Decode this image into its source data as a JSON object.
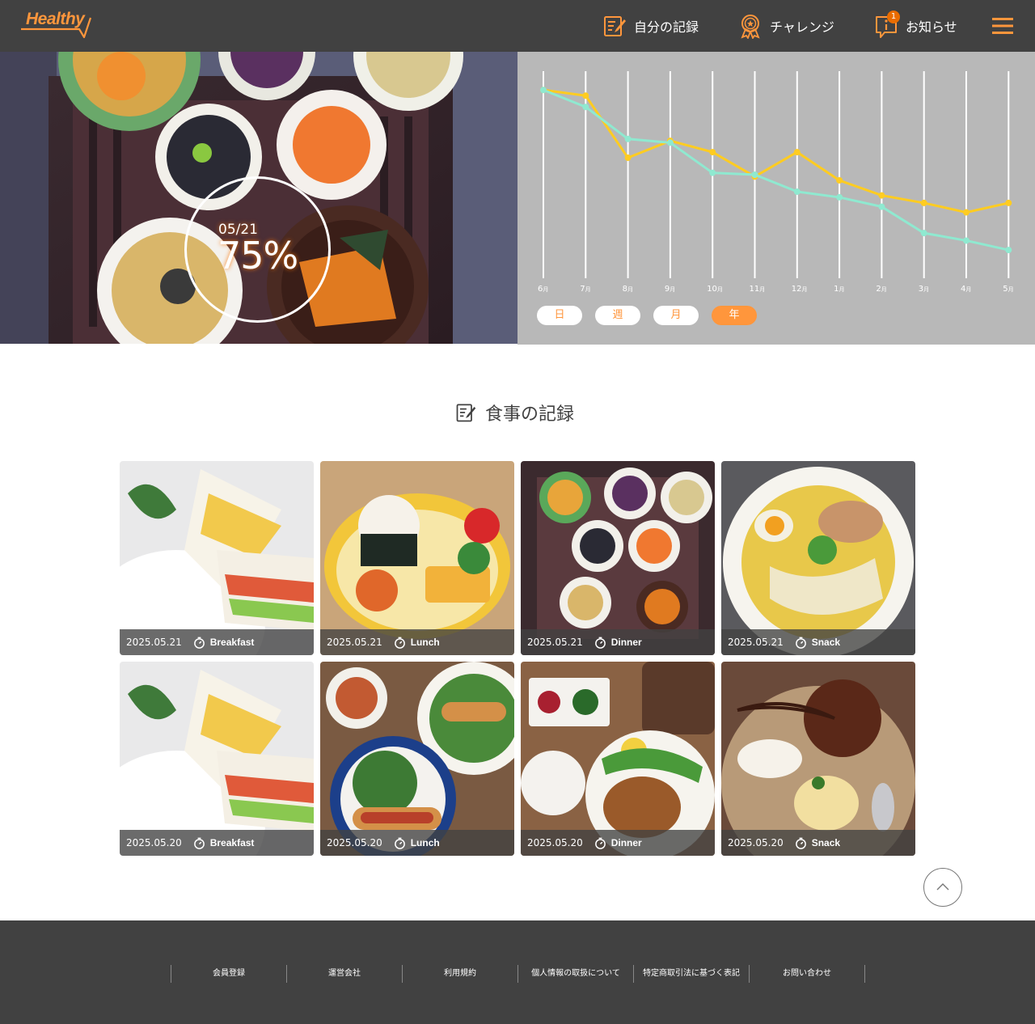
{
  "header": {
    "logo": "Healthy",
    "nav": [
      {
        "label": "自分の記録",
        "icon": "memo-icon"
      },
      {
        "label": "チャレンジ",
        "icon": "medal-icon"
      },
      {
        "label": "お知らせ",
        "icon": "info-icon",
        "badge": "1"
      }
    ],
    "menu_icon": "hamburger-icon"
  },
  "hero": {
    "date": "05/21",
    "percent": "75%",
    "achievement_rate": 0.75
  },
  "chart_data": {
    "type": "line",
    "categories": [
      "6",
      "7",
      "8",
      "9",
      "10",
      "11",
      "12",
      "1",
      "2",
      "3",
      "4",
      "5"
    ],
    "month_unit": "月",
    "series": [
      {
        "color": "#FFCC21",
        "values": [
          100,
          97,
          64,
          73,
          67,
          54,
          67,
          52,
          44,
          40,
          35,
          40
        ]
      },
      {
        "color": "#8FE9D0",
        "values": [
          100,
          91,
          74,
          72,
          56,
          55,
          46,
          43,
          38,
          24,
          20,
          15
        ]
      }
    ],
    "ylim": [
      0,
      110
    ],
    "grid": "vertical",
    "legend": "none"
  },
  "range_buttons": [
    "日",
    "週",
    "月",
    "年"
  ],
  "range_selected": "年",
  "meals_section": {
    "title": "食事の記録",
    "icon": "memo-icon"
  },
  "meals": [
    {
      "date": "2025.05.21",
      "meal": "Breakfast",
      "kind": "sandwich"
    },
    {
      "date": "2025.05.21",
      "meal": "Lunch",
      "kind": "bento"
    },
    {
      "date": "2025.05.21",
      "meal": "Dinner",
      "kind": "dishes"
    },
    {
      "date": "2025.05.21",
      "meal": "Snack",
      "kind": "ramen"
    },
    {
      "date": "2025.05.20",
      "meal": "Breakfast",
      "kind": "sandwich"
    },
    {
      "date": "2025.05.20",
      "meal": "Lunch",
      "kind": "hotdog"
    },
    {
      "date": "2025.05.20",
      "meal": "Dinner",
      "kind": "chicken"
    },
    {
      "date": "2025.05.20",
      "meal": "Snack",
      "kind": "cake"
    }
  ],
  "colors": {
    "header_bg": "#414141",
    "accent": "#FF963C",
    "chart_bg": "#B8B8B8",
    "line_yellow": "#FFCC21",
    "line_mint": "#8FE9D0"
  },
  "footer": {
    "links": [
      "会員登録",
      "運営会社",
      "利用規約",
      "個人情報の取扱について",
      "特定商取引法に基づく表記",
      "お問い合わせ"
    ]
  }
}
